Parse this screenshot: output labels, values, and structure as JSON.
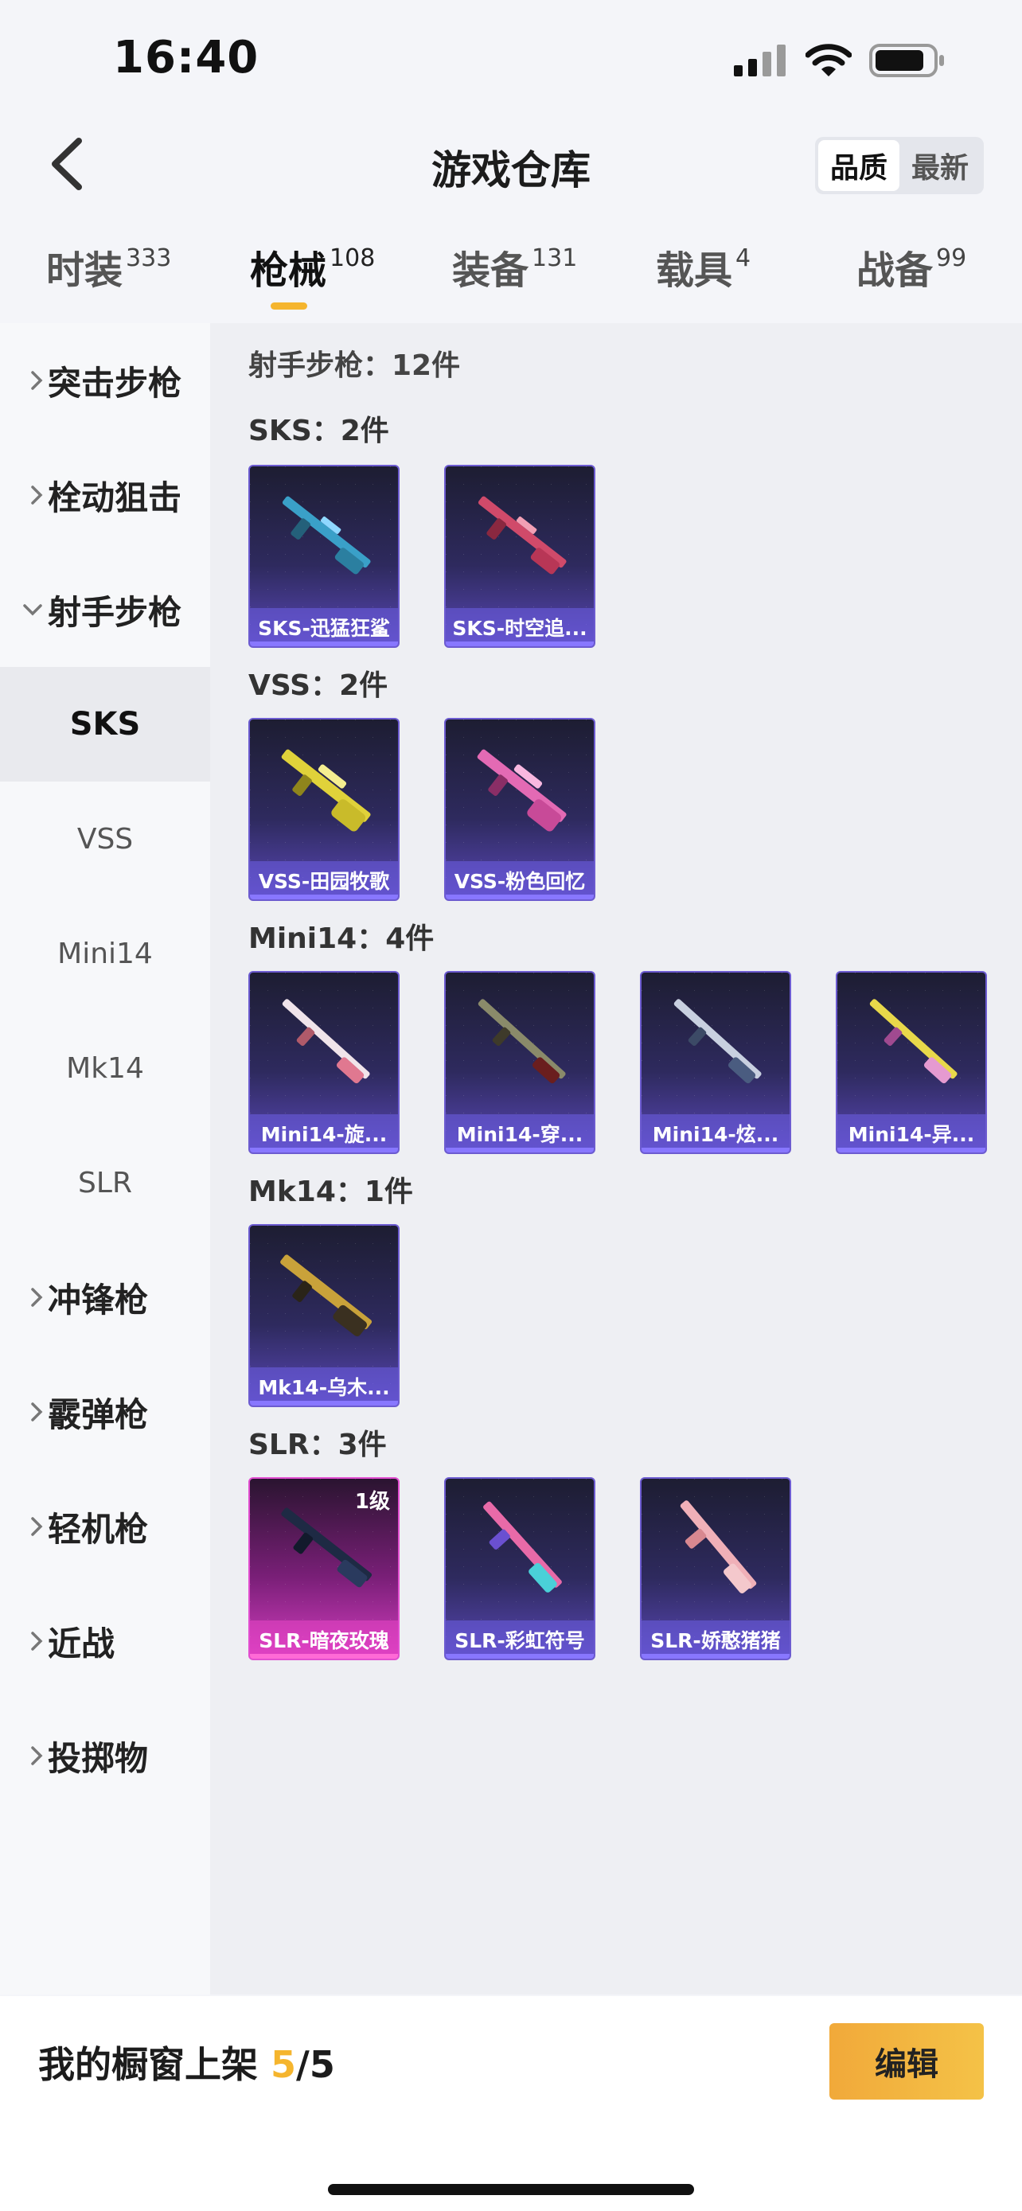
{
  "status_bar": {
    "time": "16:40"
  },
  "header": {
    "title": "游戏仓库",
    "sort_options": [
      "品质",
      "最新"
    ],
    "active_sort": "品质"
  },
  "tabs": [
    {
      "label": "时装",
      "count": "333"
    },
    {
      "label": "枪械",
      "count": "108"
    },
    {
      "label": "装备",
      "count": "131"
    },
    {
      "label": "载具",
      "count": "4"
    },
    {
      "label": "战备",
      "count": "99"
    }
  ],
  "active_tab": "枪械",
  "sidebar": {
    "categories": [
      "突击步枪",
      "栓动狙击",
      "射手步枪",
      "冲锋枪",
      "霰弹枪",
      "轻机枪",
      "近战",
      "投掷物"
    ],
    "expanded": "射手步枪",
    "sub_items": [
      "SKS",
      "VSS",
      "Mini14",
      "Mk14",
      "SLR"
    ],
    "active_sub": "SKS"
  },
  "content": {
    "category_title": "射手步枪：12件",
    "groups": [
      {
        "title": "SKS：2件",
        "items": [
          "SKS-迅猛狂鲨",
          "SKS-时空追..."
        ]
      },
      {
        "title": "VSS：2件",
        "items": [
          "VSS-田园牧歌",
          "VSS-粉色回忆"
        ]
      },
      {
        "title": "Mini14：4件",
        "items": [
          "Mini14-旋...",
          "Mini14-穿...",
          "Mini14-炫...",
          "Mini14-异..."
        ]
      },
      {
        "title": "Mk14：1件",
        "items": [
          "Mk14-乌木..."
        ]
      },
      {
        "title": "SLR：3件",
        "items": [
          "SLR-暗夜玫瑰",
          "SLR-彩虹符号",
          "SLR-娇憨猪猪"
        ]
      }
    ],
    "slr_level_badge": "1级"
  },
  "bottom": {
    "shelf_label": "我的橱窗上架",
    "shelf_current": "5",
    "shelf_sep": "/",
    "shelf_total": "5",
    "edit_label": "编辑"
  },
  "colors": {
    "accent": "#f5b52e",
    "card_purple": "#5947b6",
    "card_pink": "#d33dbf"
  }
}
